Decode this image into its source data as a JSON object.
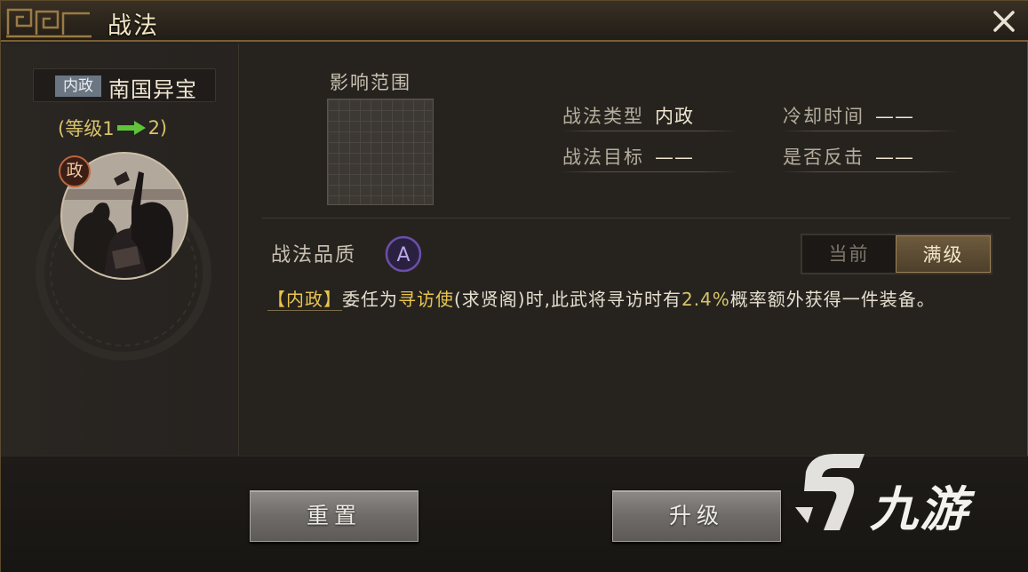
{
  "window": {
    "title": "战法",
    "close_glyph": "X"
  },
  "left": {
    "type_tag": "内政",
    "skill_name": "南国异宝",
    "level_open": "(等级1",
    "level_close": "2)",
    "portrait_badge": "政"
  },
  "right": {
    "range_label": "影响范围",
    "stats": {
      "type_label": "战法类型",
      "type_value": "内政",
      "cooldown_label": "冷却时间",
      "cooldown_value": "——",
      "target_label": "战法目标",
      "target_value": "——",
      "counter_label": "是否反击",
      "counter_value": "——"
    },
    "quality_label": "战法品质",
    "quality_grade": "A",
    "toggle": {
      "current": "当前",
      "max": "满级",
      "selected": "max"
    },
    "description": {
      "tag": "【内政】",
      "p1": "委任为",
      "kw": "寻访使",
      "p2": "(求贤阁)时,此武将寻访时有",
      "hl": "2.4%",
      "p3": "概率额外获得一件装备。"
    }
  },
  "buttons": {
    "reset": "重置",
    "upgrade": "升级"
  },
  "watermark": {
    "text": "九游"
  },
  "colors": {
    "gold": "#e8c44e",
    "panel": "#26231f",
    "accent_border": "#7a5f34",
    "quality_purple": "#6a4fa8"
  }
}
